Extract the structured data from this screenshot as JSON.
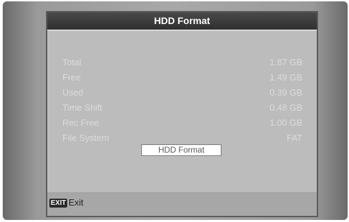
{
  "window": {
    "title": "HDD Format"
  },
  "info_rows": [
    {
      "label": "Total",
      "value": "1.87 GB"
    },
    {
      "label": "Free",
      "value": "1.49 GB"
    },
    {
      "label": "Used",
      "value": "0.39 GB"
    },
    {
      "label": "Time Shift",
      "value": "0.48 GB"
    },
    {
      "label": "Rec Free",
      "value": "1.00 GB"
    },
    {
      "label": "File System",
      "value": "FAT"
    }
  ],
  "actions": {
    "format_label": "HDD Format"
  },
  "footer": {
    "exit_key": "EXIT",
    "exit_label": "Exit"
  }
}
